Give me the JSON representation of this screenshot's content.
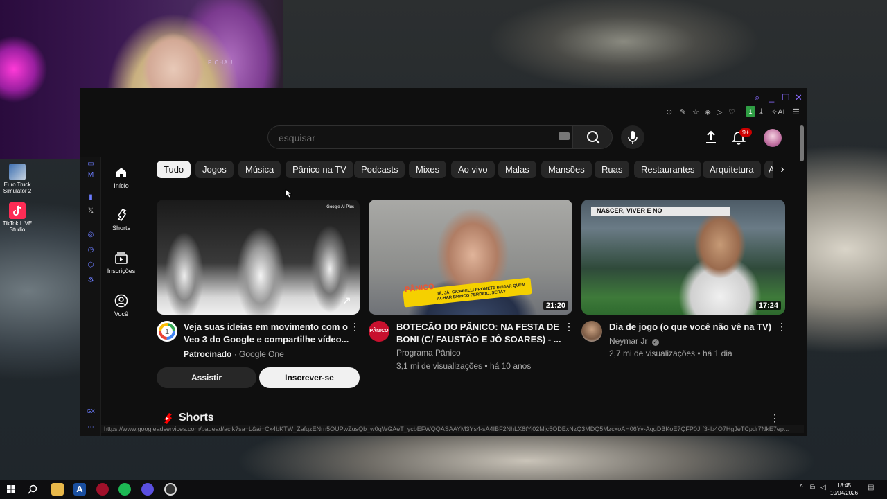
{
  "desktop": {
    "icons": [
      {
        "label": "Euro Truck Simulator 2",
        "icon": "truck-icon"
      },
      {
        "label": "TikTok LIVE Studio",
        "icon": "tiktok-icon"
      }
    ]
  },
  "webcam": {
    "chair_text": "PICHAU"
  },
  "youtube": {
    "search": {
      "placeholder": "Pesquisar",
      "visible_text": "esquisar"
    },
    "notifications_badge": "9+",
    "nav": [
      {
        "label": "Início",
        "icon": "home-icon"
      },
      {
        "label": "Shorts",
        "icon": "shorts-icon"
      },
      {
        "label": "Inscrições",
        "icon": "subscriptions-icon"
      },
      {
        "label": "Você",
        "icon": "you-icon"
      }
    ],
    "chips": [
      "Tudo",
      "Jogos",
      "Música",
      "Pânico na TV",
      "Podcasts",
      "Mixes",
      "Ao vivo",
      "Malas",
      "Mansões",
      "Ruas",
      "Restaurantes",
      "Arquitetura",
      "A"
    ],
    "active_chip": "Tudo",
    "videos": [
      {
        "title_line1": "Veja suas ideias em movimento com o",
        "title_line2": "Veo 3 do Google e compartilhe vídeo...",
        "sponsored": "Patrocinado",
        "channel": "Google One",
        "ad_badge": "Google AI Plus",
        "btn_secondary": "Assistir",
        "btn_primary": "Inscrever-se"
      },
      {
        "title_line1": "BOTECÃO DO PÂNICO: NA FESTA DE",
        "title_line2": "BONI (C/ FAUSTÃO E JÔ SOARES) - ...",
        "channel": "Programa Pânico",
        "views": "3,1 mi de visualizações",
        "age": "há 10 anos",
        "duration": "21:20",
        "thumb_caption": "JÁ, JÁ: CICARELLI PROMETE BEIJAR QUEM ACHAR BRINCO PERDIDO. SERÁ?",
        "thumb_logo": "PÂNICO"
      },
      {
        "title_line1": "Dia de jogo (o que você não vê na TV)",
        "channel": "Neymar Jr",
        "views": "2,7 mi de visualizações",
        "age": "há 1 dia",
        "duration": "17:24",
        "thumb_caption": "NASCER, VIVER E NO"
      }
    ],
    "shorts_heading": "Shorts",
    "status_url": "https://www.googleadservices.com/pagead/aclk?sa=L&ai=Cx4bKTW_ZafqzENrn5OUPwZusQb_w0qWGAeT_ycbEFWQQASAAYM3Ys4-sA4IBF2NhLX8tYi02Mjc5ODExNzQ3MDQ5MzcxoAH06Yv-AqgDBKoE7QFP0Jrf3-lb4O7HgJeTCpdr7NkE7ep..."
  },
  "browser_extension_badge": "1",
  "ai_label": "AI",
  "taskbar": {
    "time": "18:45",
    "date": "10/04/2026"
  },
  "colors": {
    "yt_bg": "#0f0f0f",
    "chip_bg": "#272727",
    "accent_red": "#ff0000",
    "browser_accent": "#8a6bff"
  }
}
